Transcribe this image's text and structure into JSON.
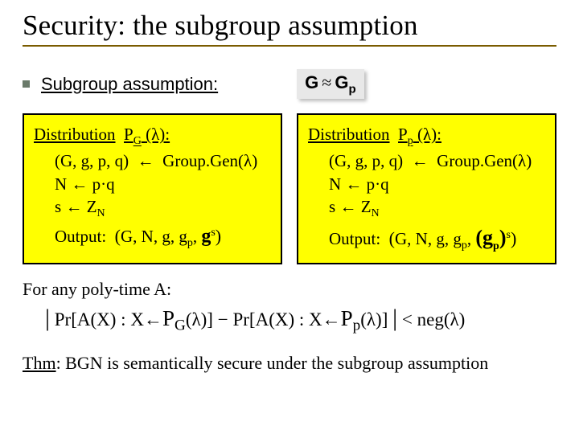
{
  "title": "Security:   the subgroup assumption",
  "row1": {
    "label": "Subgroup assumption:",
    "G_left": "G",
    "approx": "≈",
    "G_right": "G",
    "G_right_sub": "p"
  },
  "leftBox": {
    "hdr_prefix": "Distribution",
    "hdr_P": "P",
    "hdr_Psub": "G",
    "hdr_arg": "(λ):",
    "l1_a": "(G, g, p, q)",
    "l1_arrow": "←",
    "l1_b": "Group.Gen(λ)",
    "l2_a": "N",
    "l2_arrow": "←",
    "l2_b": "p·q",
    "l3_a": "s",
    "l3_arrow": "←",
    "l3_b": "Z",
    "l3_bsub": "N",
    "out_label": "Output:",
    "out_open": "(",
    "out_body": "G, N, g, g",
    "out_body_sub": "p",
    "out_comma": ",",
    "out_g": "g",
    "out_g_sup": "s",
    "out_close": ")"
  },
  "rightBox": {
    "hdr_prefix": "Distribution",
    "hdr_P": "P",
    "hdr_Psub": "p",
    "hdr_arg": "(λ):",
    "l1_a": "(G, g, p, q)",
    "l1_arrow": "←",
    "l1_b": "Group.Gen(λ)",
    "l2_a": "N",
    "l2_arrow": "←",
    "l2_b": "p·q",
    "l3_a": "s",
    "l3_arrow": "←",
    "l3_b": "Z",
    "l3_bsub": "N",
    "out_label": "Output:",
    "out_open": "(",
    "out_body": "G, N, g, g",
    "out_body_sub": "p",
    "out_comma": ",",
    "out_gp_open": "(g",
    "out_gp_sub": "p",
    "out_gp_close": ")",
    "out_gp_sup": "s",
    "out_close": ")"
  },
  "forAny": "For any poly-time A:",
  "prLine": {
    "abs_open": "|",
    "Pr1": "Pr",
    "br_open1": "[",
    "AX1": "A(X) : X",
    "arrow1": "←",
    "P1": "P",
    "P1sub": "G",
    "P1arg": "(λ)",
    "br_close1": "]",
    "minus": " − ",
    "Pr2": "Pr",
    "br_open2": "[",
    "AX2": "A(X) : X",
    "arrow2": "←",
    "P2": "P",
    "P2sub": "p",
    "P2arg": "(λ)",
    "br_close2": "]",
    "abs_close": "|",
    "lt": "  <  ",
    "neg": "neg(λ)"
  },
  "thm": {
    "label": "Thm",
    "body": ":   BGN is semantically secure under the subgroup assumption"
  }
}
